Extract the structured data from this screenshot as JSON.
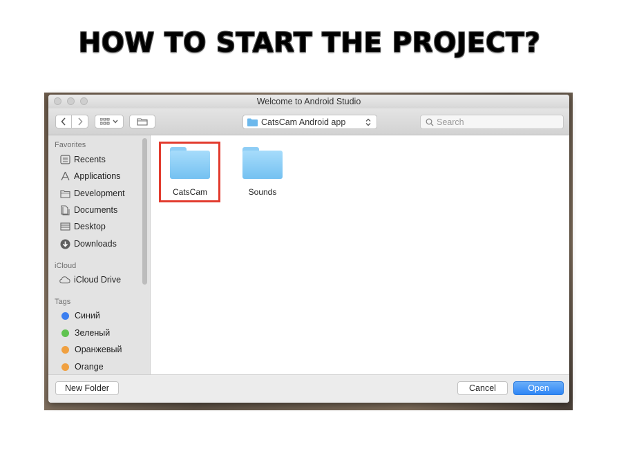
{
  "slide": {
    "title": "HOW TO START THE PROJECT?"
  },
  "window": {
    "title": "Welcome to Android Studio"
  },
  "toolbar": {
    "back_icon": "chevron-left-icon",
    "forward_icon": "chevron-right-icon",
    "view_icon": "grid-view-icon",
    "new_folder_icon": "folder-outline-icon",
    "location": "CatsCam Android app",
    "search_placeholder": "Search"
  },
  "sidebar": {
    "favorites_header": "Favorites",
    "favorites": [
      {
        "label": "Recents",
        "icon": "recents-icon"
      },
      {
        "label": "Applications",
        "icon": "applications-icon"
      },
      {
        "label": "Development",
        "icon": "folder-icon"
      },
      {
        "label": "Documents",
        "icon": "documents-icon"
      },
      {
        "label": "Desktop",
        "icon": "desktop-icon"
      },
      {
        "label": "Downloads",
        "icon": "downloads-icon"
      }
    ],
    "icloud_header": "iCloud",
    "icloud": [
      {
        "label": "iCloud Drive",
        "icon": "cloud-icon"
      }
    ],
    "tags_header": "Tags",
    "tags": [
      {
        "label": "Синий",
        "color": "#3b7ff0"
      },
      {
        "label": "Зеленый",
        "color": "#5fc350"
      },
      {
        "label": "Оранжевый",
        "color": "#f0a040"
      },
      {
        "label": "Orange",
        "color": "#f0a040"
      }
    ]
  },
  "files": [
    {
      "name": "CatsCam",
      "selected": true
    },
    {
      "name": "Sounds",
      "selected": false
    }
  ],
  "highlight_color": "#e23b2e",
  "footer": {
    "new_folder": "New Folder",
    "cancel": "Cancel",
    "open": "Open"
  }
}
